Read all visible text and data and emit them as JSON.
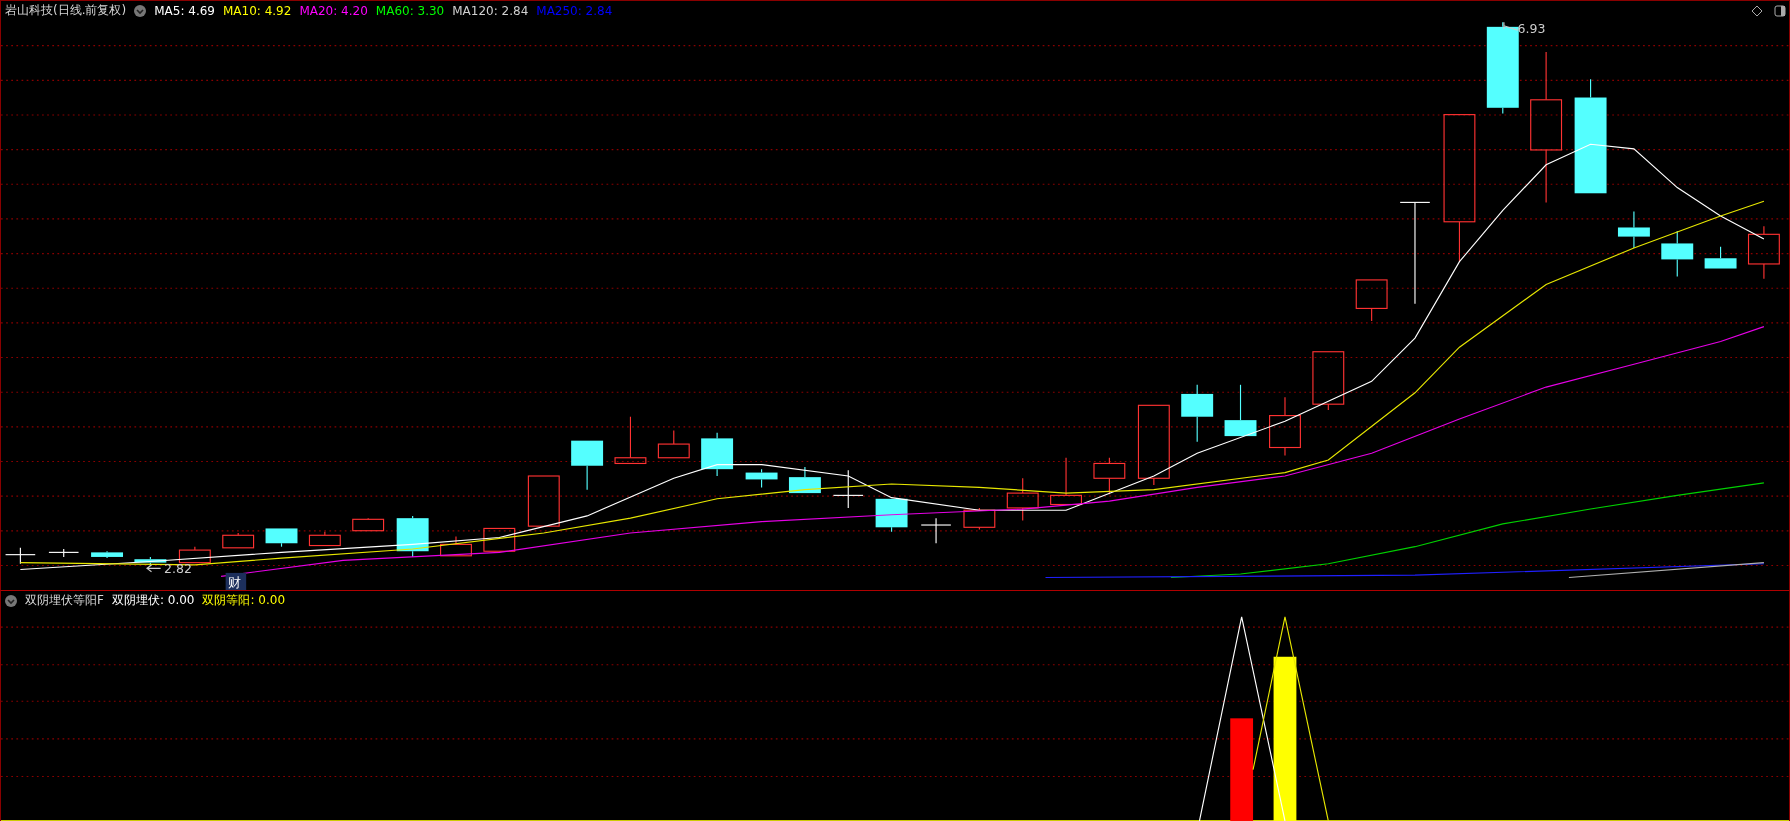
{
  "main_chart": {
    "title": "岩山科技(日线.前复权)",
    "ma_legend": [
      {
        "text": "MA5: 4.69",
        "color": "#ffffff"
      },
      {
        "text": "MA10: 4.92",
        "color": "#ffff00"
      },
      {
        "text": "MA20: 4.20",
        "color": "#ff00ff"
      },
      {
        "text": "MA60: 3.30",
        "color": "#00ff00"
      },
      {
        "text": "MA120: 2.84",
        "color": "#d0d0d0"
      },
      {
        "text": "MA250: 2.84",
        "color": "#0000ff"
      }
    ],
    "low_label": "2.82",
    "high_label": "6.93",
    "event_marker": "财"
  },
  "indicator": {
    "name": "双阴埋伏等阳F",
    "legend": [
      {
        "text": "双阴埋伏: 0.00",
        "color": "#ffffff"
      },
      {
        "text": "双阴等阳: 0.00",
        "color": "#ffff00"
      }
    ]
  }
}
